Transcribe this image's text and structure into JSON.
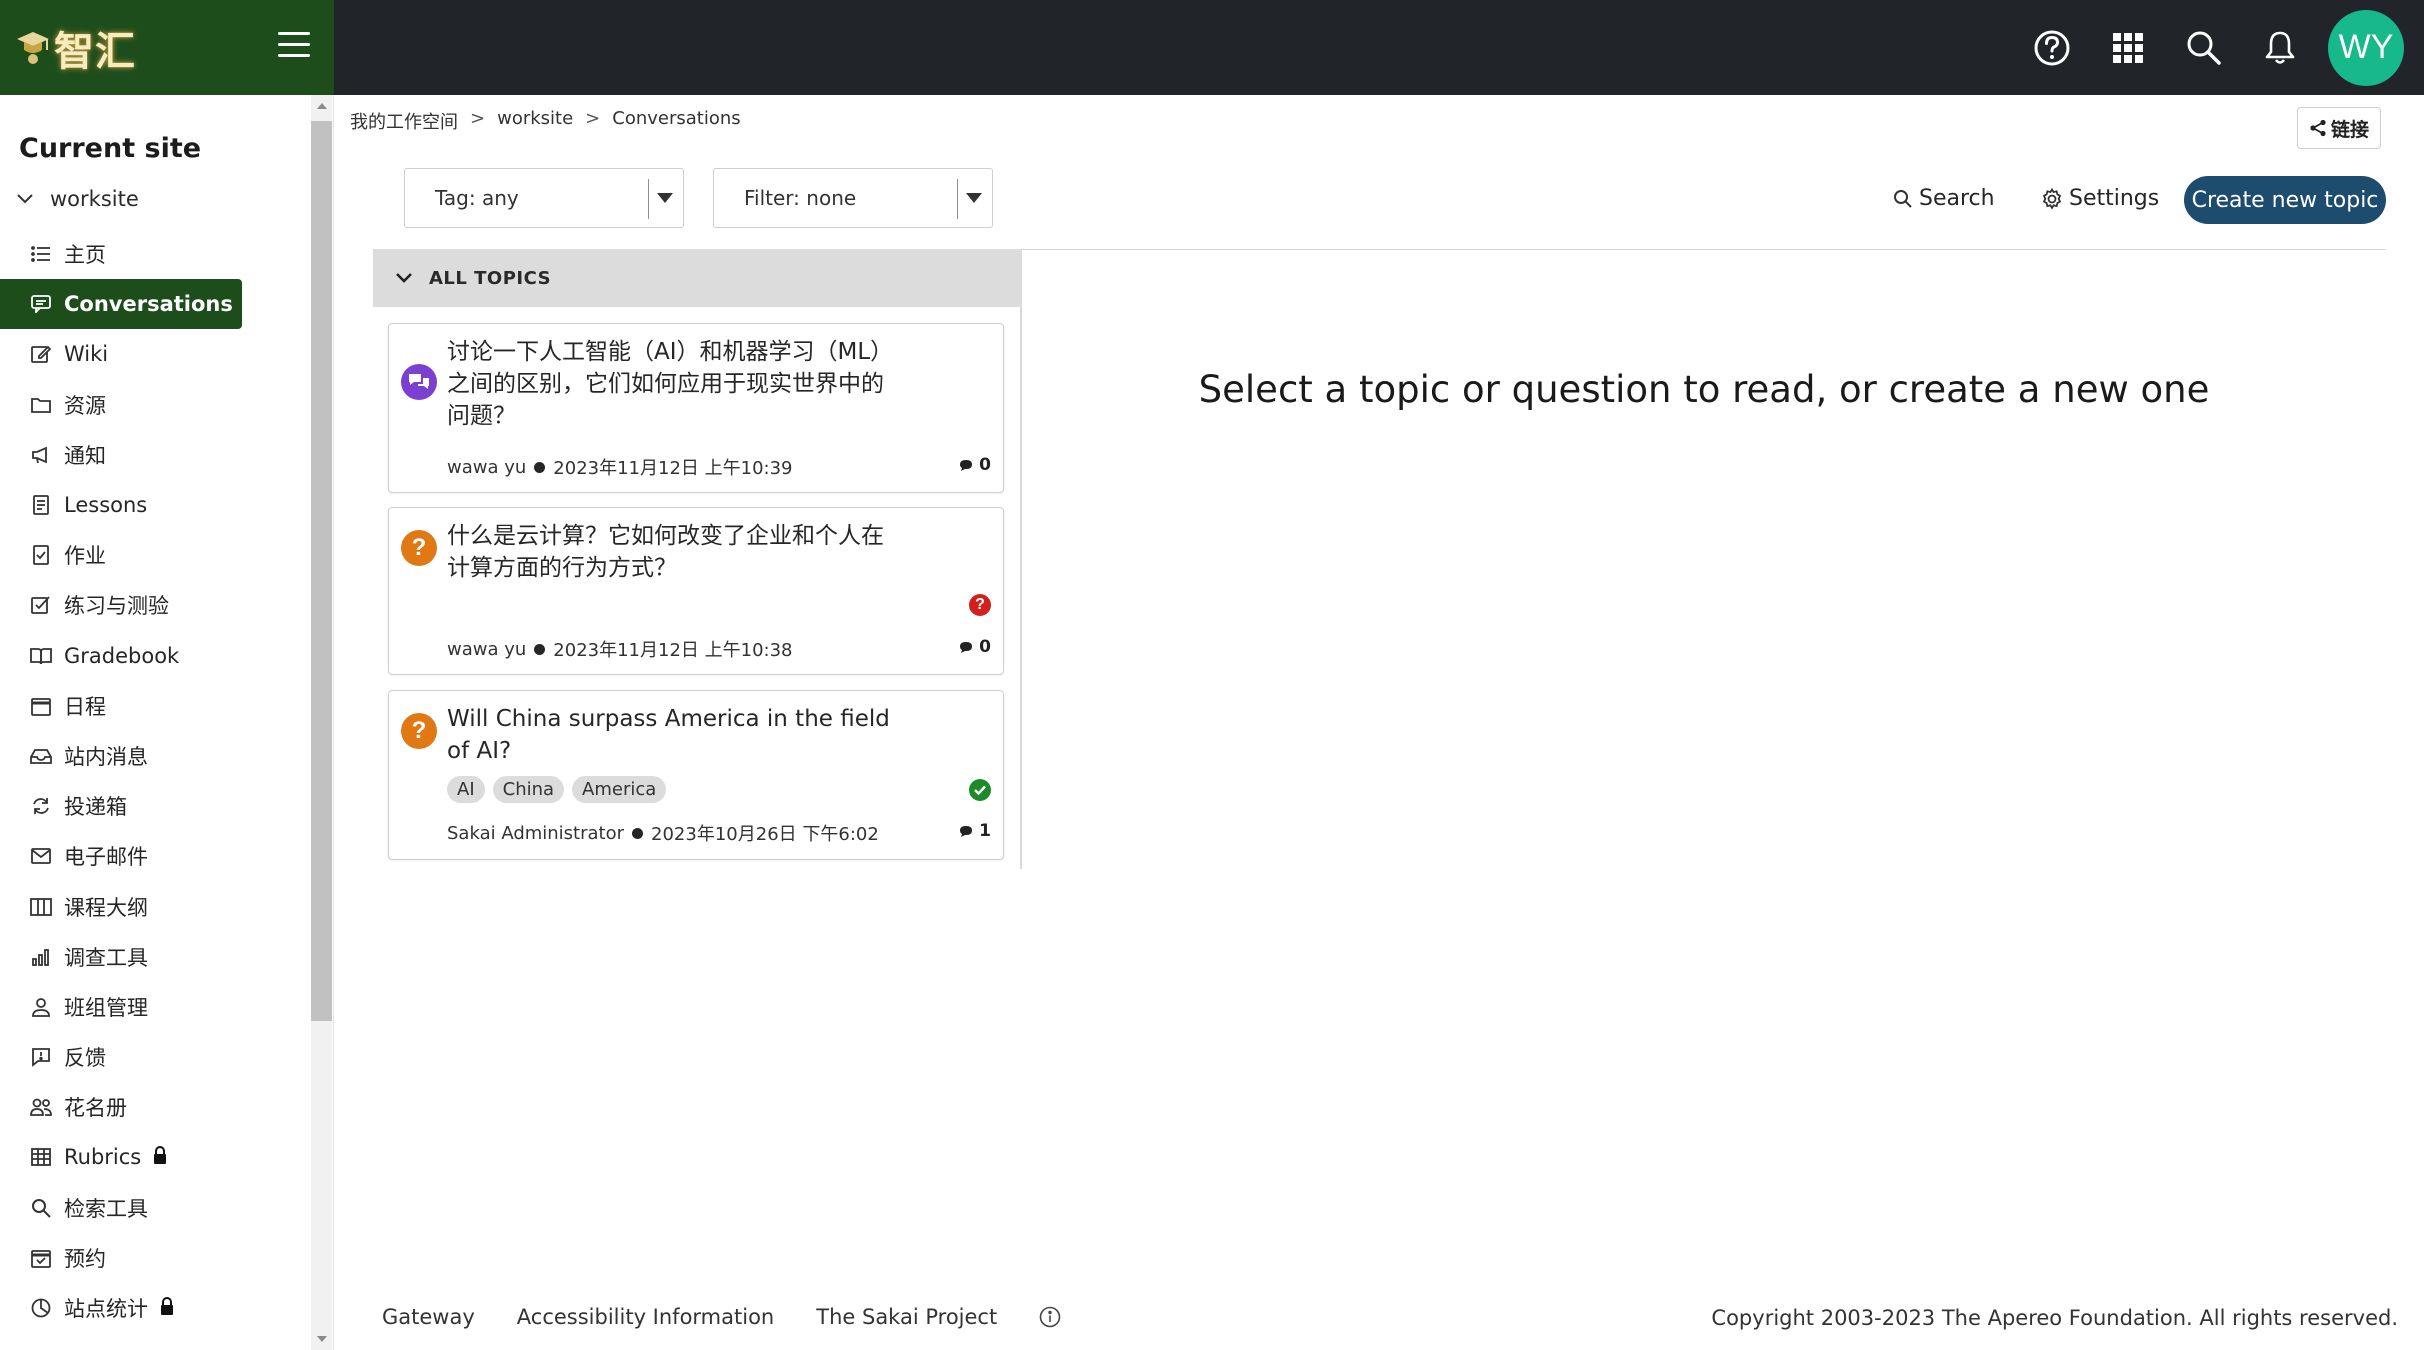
{
  "brand": {
    "logo_text": "智汇",
    "menu_icon": "hamburger-icon"
  },
  "topbar": {
    "icons": [
      "help-icon",
      "apps-grid-icon",
      "search-icon",
      "bell-icon"
    ],
    "avatar_initials": "WY",
    "avatar_color": "#17b889",
    "background": "#212529"
  },
  "sidebar": {
    "heading": "Current site",
    "site_name": "worksite",
    "active_color": "#1e4d1c",
    "items": [
      {
        "label": "主页",
        "icon": "list-icon"
      },
      {
        "label": "Conversations",
        "icon": "chat-icon",
        "active": true
      },
      {
        "label": "Wiki",
        "icon": "pencil-icon"
      },
      {
        "label": "资源",
        "icon": "folder-icon"
      },
      {
        "label": "通知",
        "icon": "megaphone-icon"
      },
      {
        "label": "Lessons",
        "icon": "document-icon"
      },
      {
        "label": "作业",
        "icon": "assignment-icon"
      },
      {
        "label": "练习与测验",
        "icon": "checkbox-icon"
      },
      {
        "label": "Gradebook",
        "icon": "book-icon"
      },
      {
        "label": "日程",
        "icon": "calendar-icon"
      },
      {
        "label": "站内消息",
        "icon": "inbox-icon"
      },
      {
        "label": "投递箱",
        "icon": "refresh-icon"
      },
      {
        "label": "电子邮件",
        "icon": "envelope-icon"
      },
      {
        "label": "课程大纲",
        "icon": "columns-icon"
      },
      {
        "label": "调查工具",
        "icon": "bar-chart-icon"
      },
      {
        "label": "班组管理",
        "icon": "person-icon"
      },
      {
        "label": "反馈",
        "icon": "feedback-icon"
      },
      {
        "label": "花名册",
        "icon": "people-icon"
      },
      {
        "label": "Rubrics",
        "icon": "table-icon",
        "locked": true
      },
      {
        "label": "检索工具",
        "icon": "magnifier-icon"
      },
      {
        "label": "预约",
        "icon": "calendar-check-icon"
      },
      {
        "label": "站点统计",
        "icon": "pie-chart-icon",
        "locked": true
      }
    ]
  },
  "breadcrumb": {
    "items": [
      "我的工作空间",
      "worksite",
      "Conversations"
    ],
    "separator": ">"
  },
  "link_button": {
    "label": "链接",
    "icon": "share-icon"
  },
  "filters": {
    "tag_select": "Tag: any",
    "filter_select": "Filter: none"
  },
  "toolbar": {
    "search_label": "Search",
    "settings_label": "Settings",
    "create_label": "Create new topic",
    "create_color": "#1d4c6e"
  },
  "topics": {
    "header": "ALL TOPICS",
    "items": [
      {
        "type": "discussion",
        "title": "讨论一下人工智能（AI）和机器学习（ML）之间的区别，它们如何应用于现实世界中的问题？",
        "author": "wawa yu",
        "date": "2023年11月12日 上午10:39",
        "count": "0"
      },
      {
        "type": "question",
        "title": "什么是云计算？它如何改变了企业和个人在计算方面的行为方式？",
        "author": "wawa yu",
        "date": "2023年11月12日 上午10:38",
        "count": "0",
        "status": "unanswered"
      },
      {
        "type": "question",
        "title": "Will China surpass America in the field of AI?",
        "tags": [
          "AI",
          "China",
          "America"
        ],
        "author": "Sakai Administrator",
        "date": "2023年10月26日 下午6:02",
        "count": "1",
        "status": "answered"
      }
    ]
  },
  "main": {
    "empty_message": "Select a topic or question to read, or create a new one"
  },
  "footer": {
    "links": [
      "Gateway",
      "Accessibility Information",
      "The Sakai Project"
    ],
    "info_icon": "info-icon",
    "copyright": "Copyright 2003-2023 The Apereo Foundation. All rights reserved."
  }
}
